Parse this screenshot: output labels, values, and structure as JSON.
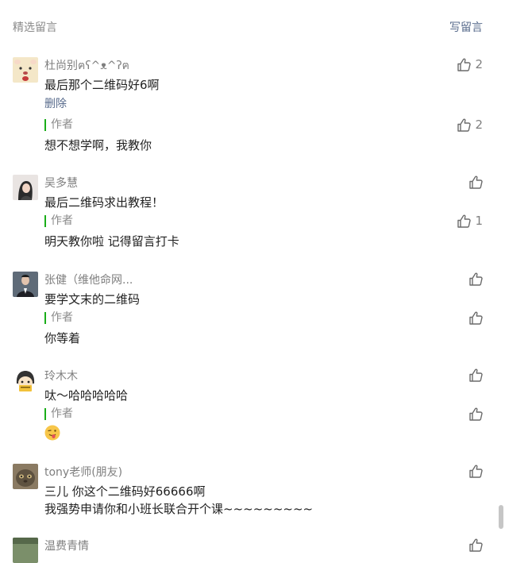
{
  "header": {
    "title": "精选留言",
    "write": "写留言"
  },
  "comments": [
    {
      "name": "杜尚别ฅʕ^ᴥ^ʔฅ",
      "text": "最后那个二维码好6啊",
      "delete": "删除",
      "likes": "2",
      "reply": {
        "label": "作者",
        "text": "想不想学啊，我教你",
        "likes": "2"
      }
    },
    {
      "name": "吴多慧",
      "text": "最后二维码求出教程！",
      "likes": "",
      "reply": {
        "label": "作者",
        "text": "明天教你啦  记得留言打卡",
        "likes": "1"
      }
    },
    {
      "name": "张健（维他命网...",
      "text": "要学文末的二维码",
      "likes": "",
      "reply": {
        "label": "作者",
        "text": "你等着",
        "likes": ""
      }
    },
    {
      "name": "玲木木",
      "text": "呔～哈哈哈哈哈",
      "likes": "",
      "reply": {
        "label": "作者",
        "emoji": "tongue-out-emoji",
        "likes": ""
      }
    },
    {
      "name": "tony老师(朋友)",
      "text": "三儿 你这个二维码好66666啊",
      "text2": "我强势申请你和小班长联合开个课~~~~~~~~~",
      "likes": ""
    },
    {
      "name": "温费青情",
      "likes": ""
    }
  ],
  "colors": {
    "link": "#586b8c",
    "author_bar": "#1aad19",
    "muted": "#7f7f7f"
  }
}
